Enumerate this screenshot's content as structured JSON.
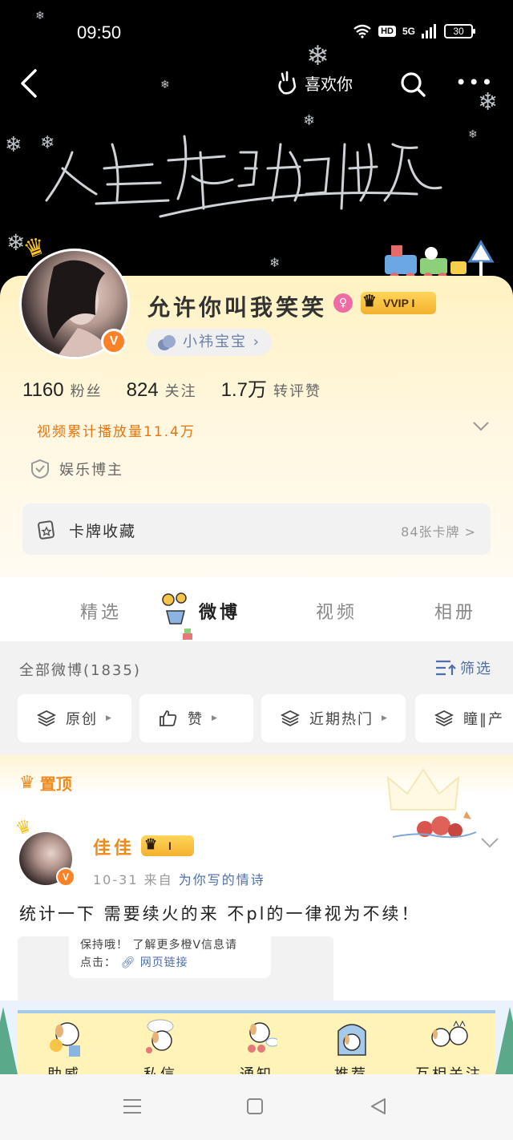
{
  "status_bar": {
    "time": "09:50",
    "hd": "HD",
    "signal": "5G",
    "battery": "30"
  },
  "header": {
    "like_label": "喜欢你"
  },
  "profile": {
    "nickname": "允许你叫我笑笑",
    "vip_label": "VVIP I",
    "sub_tag": "小祎宝宝",
    "stats": [
      {
        "value": "1160",
        "label": "粉丝"
      },
      {
        "value": "824",
        "label": "关注"
      },
      {
        "value": "1.7万",
        "label": "转评赞"
      }
    ],
    "play_count": "视频累计播放量11.4万",
    "role": "娱乐博主",
    "card_collection": {
      "label": "卡牌收藏",
      "count": "84张卡牌 >"
    }
  },
  "tabs": [
    {
      "label": "精选",
      "active": false
    },
    {
      "label": "微博",
      "active": true
    },
    {
      "label": "视频",
      "active": false
    },
    {
      "label": "相册",
      "active": false
    }
  ],
  "feed": {
    "all_count": "全部微博(1835)",
    "filter_label": "筛选",
    "chips": [
      "原创",
      "赞",
      "近期热门",
      "瞳‖产"
    ]
  },
  "post": {
    "pinned_label": "置顶",
    "author": "佳佳",
    "vip_label": "I",
    "date": "10-31",
    "from_prefix": "来自",
    "source": "为你写的情诗",
    "text": "统计一下 需要续火的来 不pl的一律视为不续！",
    "embed_line1": "保持哦！ 了解更多橙V信息请",
    "embed_line2_prefix": "点击：",
    "embed_link": "网页链接"
  },
  "bottom_tabs": [
    "助威",
    "私信",
    "通知",
    "推荐",
    "互相关注"
  ],
  "colors": {
    "accent_orange": "#f08a1c",
    "link_blue": "#4d6ea8",
    "header_bg": "#000000",
    "profile_bg": "#fff2c2"
  }
}
